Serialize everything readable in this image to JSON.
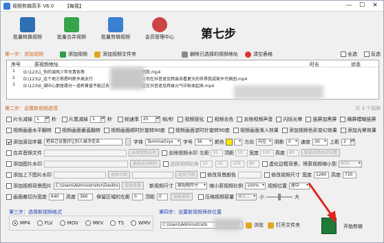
{
  "window": {
    "title": "视频剪辑高手 V6.0",
    "badge": "【每我】",
    "min_glyph": "—",
    "max_glyph": "☐",
    "close_glyph": "✕"
  },
  "toolbar": {
    "items": [
      {
        "label": "批量转换视频",
        "color": "#2e6fb5"
      },
      {
        "label": "批量合并视频",
        "color": "#35a44a"
      },
      {
        "label": "批量剪辑视频",
        "color": "#3b7fd0"
      },
      {
        "label": "会员管理中心",
        "color": "#c44"
      }
    ],
    "step_title": "第七步"
  },
  "step1": {
    "title": "第一步：添加视频",
    "add_video": "添加视频",
    "add_folder": "添加视频文件夹",
    "delete_selected": "删除已选择的视频地址",
    "clear_table": "清空表格",
    "select_all": "全选",
    "invert": "反选"
  },
  "file_table": {
    "columns": [
      "序号",
      "原视频地址",
      "时长",
      "状态"
    ],
    "rows": [
      {
        "index": "1",
        "path": "D:\\123\\1_你的调风少年天青色等",
        "tail": "雨我.mp4"
      },
      {
        "index": "2",
        "path": "D:\\123\\2_这个地方熟悉吗新乡高太行",
        "tail": "公司在抖音退见辉县去看更大的世界我成家乡代表团.mp4"
      },
      {
        "index": "3",
        "path": "D:\\123\\6_湖中心那座缘分一道桥黄昏不能过去",
        "tail": "区在抖音退见辉县元气中秋本起来.mp4"
      }
    ],
    "count_text": "共 3 个视频"
  },
  "step2": {
    "title": "第二步：设置新视频选项",
    "row1": {
      "cut_head": "片头减掉",
      "cut_head_val": "1",
      "sec1": "秒",
      "cut_tail": "片尾减掉",
      "cut_tail_val": "1",
      "sec2": "秒",
      "framerate": "帧速率",
      "framerate_val": "25",
      "fps_unit": "帧/秒",
      "sharpen": "视频锐化",
      "decolor": "视频去色",
      "remove_audio": "去除视频声音",
      "flash": "闪烁光晕",
      "v_black": "竖屏加黑屏",
      "blur_bg": "横屏模糊竖屏"
    },
    "row2": {
      "hmirror": "视频画面水平翻转",
      "vmirror": "视频画面垂直翻转",
      "rot90cw": "视频画面顺时针旋转90度",
      "rot90ccw": "视频画面逆时针旋转90度",
      "fade_in": "视频画面渐入效果",
      "fade_out": "添加视频色彩变幻效果",
      "glow": "添加光晕效果"
    },
    "row3": {
      "add_subtitle": "添加滚动字幕",
      "subtitle_text": "把自己设置好让别人悬浮走去",
      "font_label": "字体",
      "font_val": "Terminal(sys",
      "size_label": "字号",
      "size_val": "36",
      "color_label": "颜色",
      "dir_label": "方向",
      "dir_val": "向左",
      "shadow_label": "阴影",
      "shadow_val": "0",
      "speed_label": "速度",
      "speed_val": "30",
      "top_label": "上距",
      "top_val": "2"
    },
    "row4": {
      "merge_label": "合并音频文件",
      "browse_audio": "选择音频文件",
      "rm_watermark": "去除视频水印",
      "left_label": "左距",
      "left_val": "10",
      "top_label": "顶距",
      "top_val": "10",
      "width_label": "宽度",
      "width_val": "100",
      "height_label": "高度",
      "height_val": "80",
      "smart_wm": "智能去除水印位置"
    },
    "row5": {
      "add_img_wm": "添加图片水印",
      "browse_img": "选择水印图片",
      "rm_corner": "选择视频贴角",
      "left_val": "10",
      "top_val": "10",
      "w_val": "100",
      "h_val": "80",
      "blur_area": "虚化边框背景，将原视频缩小到",
      "blur_val": "90%"
    },
    "row6": {
      "add_bottom_img": "添加上下图片水印",
      "top_img": "选择上图",
      "bottom_img": "选择下图",
      "replace_bg": "修改背景颜色",
      "replace_val": "",
      "resize": "修改视频尺寸",
      "w_label": "宽度",
      "w_val": "1280",
      "h_label": "高度",
      "h_val": "720"
    },
    "row7": {
      "add_bg": "添加视频背景图片",
      "bg_path": "C:\\Users\\Administrator\\Deskto",
      "pick_bg": "选择背景",
      "new_size": "新视频尺寸",
      "new_size_val": "原视频尺寸",
      "scale": "缩小原视频比例",
      "scale_val": "100%",
      "position": "视频位置",
      "position_val": "居中"
    },
    "row8": {
      "draw_frame": "画面裁切为宽度",
      "frame_w": "640",
      "h_label": "高度",
      "frame_h": "360",
      "keep_label": "保留区域的左距",
      "keep_l": "0",
      "top_label": "顶距",
      "keep_t": "0",
      "smart_crop": "智能裁剪",
      "mode": "压缩视频容量",
      "mode_val": "模式二",
      "small": "小",
      "big": "大"
    }
  },
  "step3": {
    "title": "第三步：选择新视频格式",
    "formats": [
      "MP4",
      "FLV",
      "MOV",
      "MKV",
      "TS",
      "WMV"
    ],
    "selected": "MP4"
  },
  "step4": {
    "title": "第四步：设置新视频保存位置",
    "path": "C:\\Users\\Administrato",
    "browse": "浏览",
    "open_folder": "打开文件夹"
  },
  "start": {
    "label": "开始剪辑"
  },
  "colors": {
    "accent_orange": "#d0661a",
    "start_green": "#1f7a3a",
    "arrow_red": "#e1261c"
  }
}
